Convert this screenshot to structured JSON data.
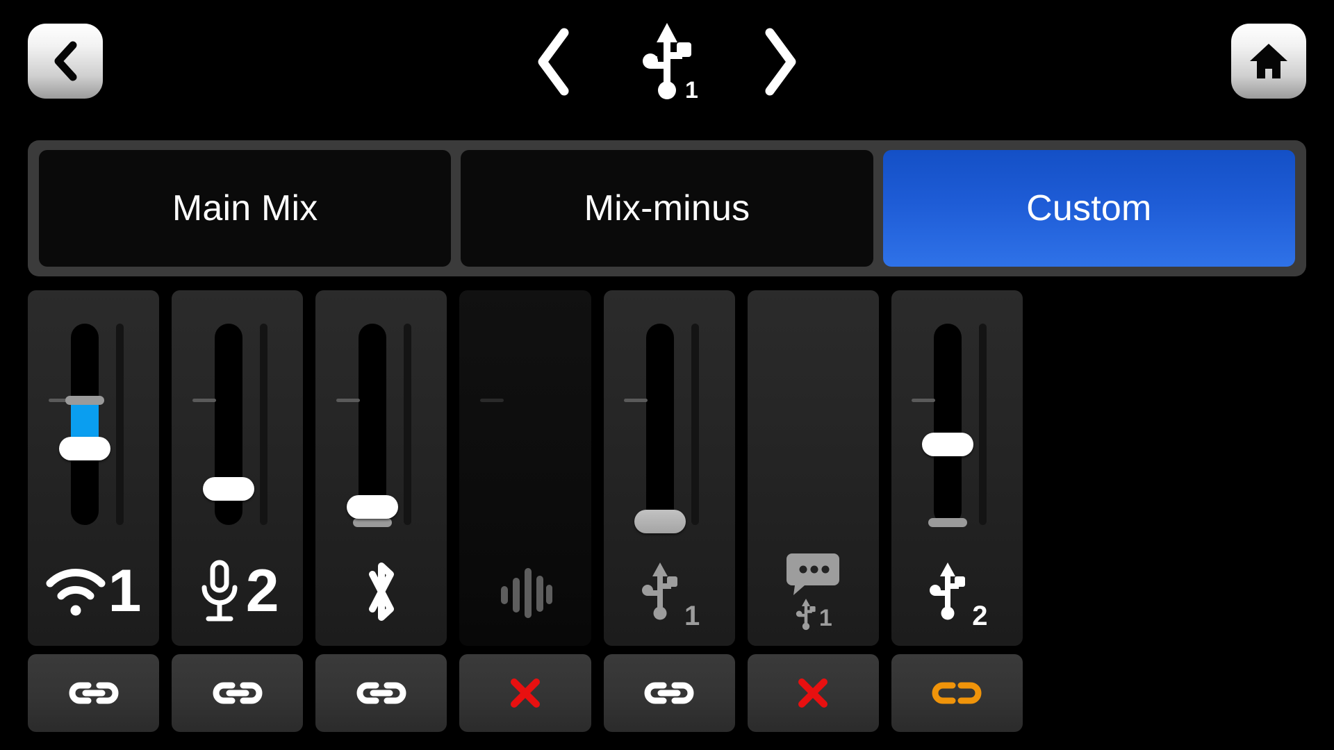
{
  "header": {
    "back_button": {
      "icon": "chevron-left-icon"
    },
    "home_button": {
      "icon": "home-icon"
    },
    "prev_button": {
      "icon": "chevron-left-icon"
    },
    "next_button": {
      "icon": "chevron-right-icon"
    },
    "output_label": "1",
    "output_icon": "usb-icon",
    "output_title": "USB 1"
  },
  "tabs": [
    {
      "label": "Main Mix",
      "active": false
    },
    {
      "label": "Mix-minus",
      "active": false
    },
    {
      "label": "Custom",
      "active": true
    }
  ],
  "colors": {
    "accent_blue": "#0a9ef0",
    "tab_active_blue": "#1e5cd6",
    "mute_red": "#e81010",
    "unlink_orange": "#f0940a",
    "handle_white": "#ffffff",
    "handle_grey": "#a4a4a4",
    "panel_grey": "#2b2b2b"
  },
  "channels": [
    {
      "id": "ch1",
      "icon": "wifi-icon",
      "number": "1",
      "enabled": true,
      "fader_percent": 62,
      "reference_percent": 38,
      "fill_from": "reference",
      "handle_style": "white",
      "cap": "reference",
      "icon_color": "#ffffff",
      "button": {
        "icon": "link-icon",
        "state": "linked",
        "color": "#ffffff"
      }
    },
    {
      "id": "ch2",
      "icon": "microphone-icon",
      "number": "2",
      "enabled": true,
      "fader_percent": 82,
      "reference_percent": 38,
      "fill_from": "none",
      "handle_style": "white",
      "cap": "none",
      "icon_color": "#ffffff",
      "button": {
        "icon": "link-icon",
        "state": "linked",
        "color": "#ffffff"
      }
    },
    {
      "id": "ch3",
      "icon": "bluetooth-icon",
      "number": "",
      "enabled": true,
      "fader_percent": 91,
      "reference_percent": 38,
      "fill_from": "bottom",
      "handle_style": "white",
      "cap": "bottom",
      "icon_color": "#ffffff",
      "button": {
        "icon": "link-icon",
        "state": "linked",
        "color": "#ffffff"
      }
    },
    {
      "id": "ch4",
      "icon": "waveform-icon",
      "number": "",
      "enabled": false,
      "fader_percent": 0,
      "reference_percent": 38,
      "fill_from": "none",
      "handle_style": "hidden",
      "cap": "none",
      "icon_color": "#5e5e5e",
      "button": {
        "icon": "close-icon",
        "state": "muted",
        "color": "#e81010"
      }
    },
    {
      "id": "ch5",
      "icon": "usb-icon",
      "number": "1",
      "enabled": true,
      "fader_percent": 100,
      "reference_percent": 38,
      "fill_from": "none",
      "handle_style": "grey",
      "cap": "none",
      "icon_color": "#9d9d9d",
      "button": {
        "icon": "link-icon",
        "state": "linked",
        "color": "#ffffff"
      }
    },
    {
      "id": "ch6",
      "icon": "chat-bubble-icon",
      "number": "1",
      "enabled": true,
      "fader_percent": null,
      "reference_percent": null,
      "fill_from": "none",
      "handle_style": "none",
      "cap": "none",
      "icon_color": "#9d9d9d",
      "button": {
        "icon": "close-icon",
        "state": "muted",
        "color": "#e81010"
      }
    },
    {
      "id": "ch7",
      "icon": "usb-icon",
      "number": "2",
      "enabled": true,
      "fader_percent": 60,
      "reference_percent": 38,
      "fill_from": "none",
      "handle_style": "white",
      "cap": "bottom",
      "icon_color": "#ffffff",
      "button": {
        "icon": "unlink-icon",
        "state": "unlinked",
        "color": "#f0940a"
      }
    }
  ]
}
